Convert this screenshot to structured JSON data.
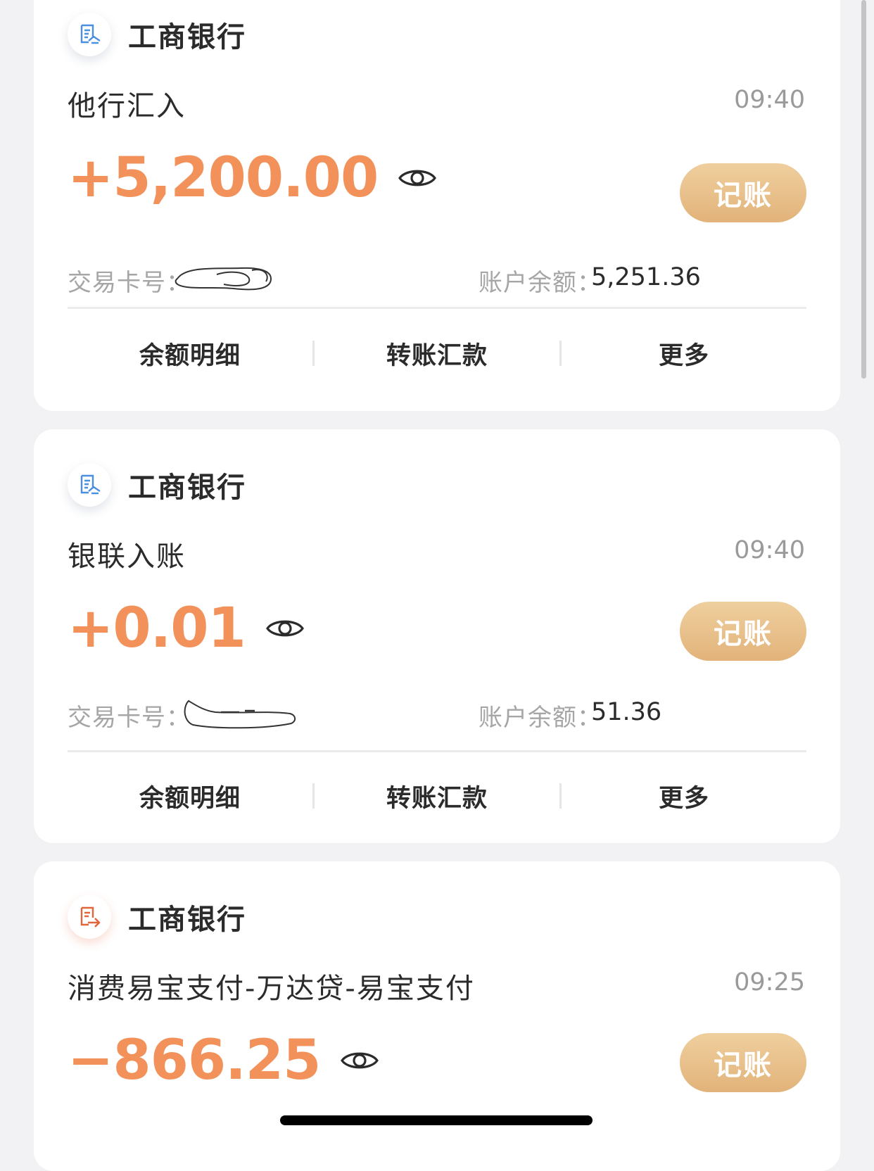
{
  "cards": [
    {
      "bank_name": "工商银行",
      "icon": "receipt-in-icon",
      "title": "他行汇入",
      "time": "09:40",
      "amount": "+5,200.00",
      "record_label": "记账",
      "card_no_label": "交易卡号：",
      "balance_label": "账户余额：",
      "balance_value": "5,251.36",
      "actions": [
        "余额明细",
        "转账汇款",
        "更多"
      ]
    },
    {
      "bank_name": "工商银行",
      "icon": "receipt-in-icon",
      "title": "银联入账",
      "time": "09:40",
      "amount": "+0.01",
      "record_label": "记账",
      "card_no_label": "交易卡号：",
      "balance_label": "账户余额：",
      "balance_value": "51.36",
      "actions": [
        "余额明细",
        "转账汇款",
        "更多"
      ]
    },
    {
      "bank_name": "工商银行",
      "icon": "receipt-out-icon",
      "title": "消费易宝支付-万达贷-易宝支付",
      "time": "09:25",
      "amount": "−866.25",
      "record_label": "记账"
    }
  ],
  "colors": {
    "amount": "#f2925a",
    "record_button": "#e8c08a",
    "icon_in": "#4a8fe0",
    "icon_out": "#e2653b"
  }
}
